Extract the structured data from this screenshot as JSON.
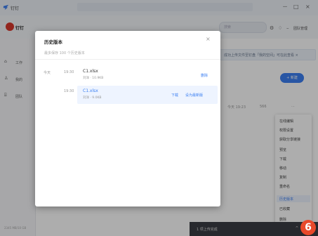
{
  "window": {
    "app_title": "钉钉",
    "controls": [
      "－",
      "□",
      "×"
    ]
  },
  "header": {
    "brand_text": "钉钉",
    "search_placeholder": "搜索",
    "icons": [
      "gear-icon",
      "bell-icon",
      "minus-icon"
    ],
    "right_link": "团队管理"
  },
  "sidebar": {
    "items": [
      {
        "icon": "home-icon",
        "glyph": "⌂",
        "label": "工作"
      },
      {
        "icon": "user-icon",
        "glyph": "♙",
        "label": "我的"
      },
      {
        "icon": "building-icon",
        "glyph": "⌸",
        "label": "团队"
      }
    ],
    "footer": "2345 MB/10 GB"
  },
  "content": {
    "banner_text": "成功上传文件至钉盘「我的空间」可在此查看 ×",
    "banner_close": "×",
    "new_button": "+ 新建",
    "columns": [
      "今天 19:23",
      "566",
      "···"
    ],
    "context_menu": [
      "在线编辑",
      "权限设置",
      "获取分享链接",
      "预览",
      "下载",
      "移动",
      "复制",
      "重命名",
      "历史版本",
      "已收藏",
      "删除"
    ],
    "active_menu_item": "历史版本"
  },
  "toast": {
    "text": "1 项上传完成",
    "caret": "⌃"
  },
  "badge": "6",
  "modal": {
    "title": "历史版本",
    "close": "×",
    "subtitle": "最多保存 100 个历史版本",
    "date_label": "今天",
    "versions": [
      {
        "time": "19:30",
        "name": "C1.xlsx",
        "meta": "刘洋 · 10.9KB",
        "actions": [
          "删除"
        ],
        "highlighted": false
      },
      {
        "time": "19:30",
        "name": "C1.xlsx",
        "meta": "刘洋 · 9.0KB",
        "actions": [
          "下载",
          "设为最新版"
        ],
        "highlighted": true
      }
    ]
  },
  "colors": {
    "accent": "#3b7ff2",
    "badge": "#e8492b",
    "brand": "#d7372c",
    "toast_bg": "#3a3d44"
  }
}
